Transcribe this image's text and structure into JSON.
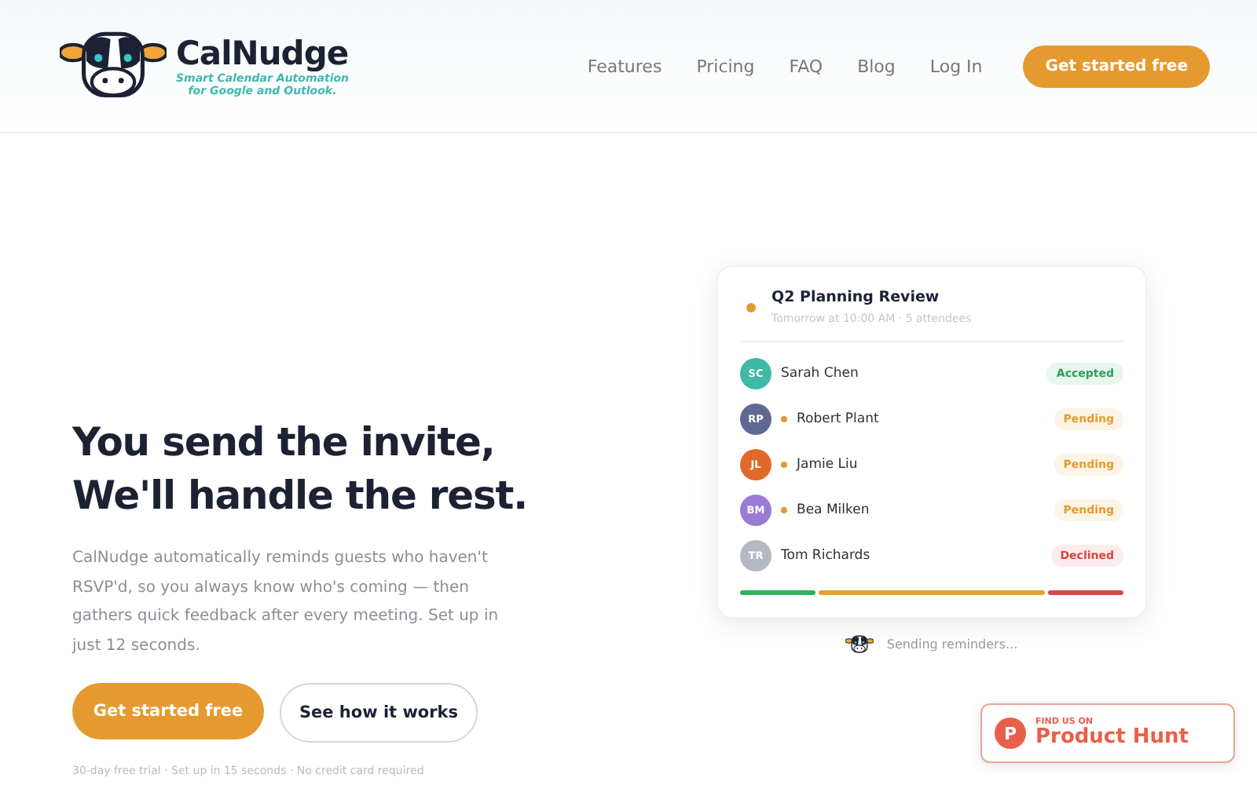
{
  "brand": {
    "name": "CalNudge",
    "tagline_1": "Smart Calendar Automation",
    "tagline_2": "for Google and Outlook."
  },
  "nav": {
    "links": [
      "Features",
      "Pricing",
      "FAQ",
      "Blog",
      "Log In"
    ],
    "cta": "Get started free"
  },
  "hero": {
    "title_1": "You send the invite,",
    "title_2": "We'll handle the rest.",
    "body": "CalNudge automatically reminds guests who haven't RSVP'd, so you always know who's coming — then gathers quick feedback after every meeting. Set up in just 12 seconds.",
    "primary": "Get started free",
    "secondary": "See how it works",
    "fine_print": "30-day free trial · Set up in 15 seconds · No credit card required"
  },
  "event": {
    "title": "Q2 Planning Review",
    "meta": "Tomorrow at 10:00 AM · 5 attendees",
    "color": "#e59a2f",
    "attendees": [
      {
        "initials": "SC",
        "name": "Sarah Chen",
        "color": "#3fb8a5",
        "kind": "accepted",
        "label": "Accepted",
        "nudged": false
      },
      {
        "initials": "RP",
        "name": "Robert Plant",
        "color": "#5e6a92",
        "kind": "pending",
        "label": "Pending",
        "nudged": true
      },
      {
        "initials": "JL",
        "name": "Jamie Liu",
        "color": "#e2692c",
        "kind": "pending",
        "label": "Pending",
        "nudged": true
      },
      {
        "initials": "BM",
        "name": "Bea Milken",
        "color": "#9a7bd6",
        "kind": "pending",
        "label": "Pending",
        "nudged": true
      },
      {
        "initials": "TR",
        "name": "Tom Richards",
        "color": "#b5b9c2",
        "kind": "declined",
        "label": "Declined",
        "nudged": false
      }
    ],
    "caption": "Sending reminders..."
  },
  "badge": {
    "eyebrow": "FIND US ON",
    "name": "Product Hunt",
    "letter": "P"
  }
}
